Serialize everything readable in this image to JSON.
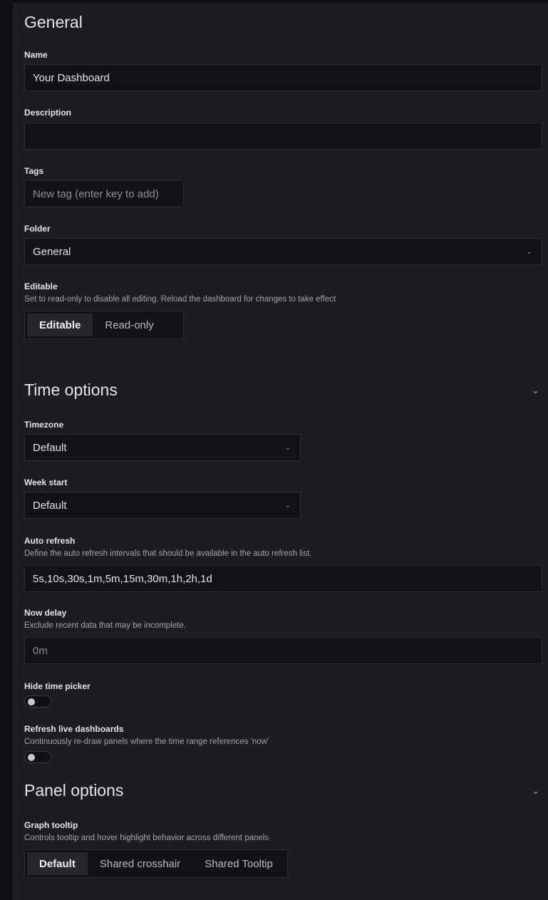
{
  "general": {
    "title": "General",
    "name_label": "Name",
    "name_value": "Your Dashboard",
    "description_label": "Description",
    "description_value": "",
    "tags_label": "Tags",
    "tags_placeholder": "New tag (enter key to add)",
    "folder_label": "Folder",
    "folder_value": "General",
    "editable_label": "Editable",
    "editable_desc": "Set to read-only to disable all editing. Reload the dashboard for changes to take effect",
    "editable_options": [
      "Editable",
      "Read-only"
    ],
    "editable_selected": "Editable"
  },
  "time_options": {
    "title": "Time options",
    "timezone_label": "Timezone",
    "timezone_value": "Default",
    "week_start_label": "Week start",
    "week_start_value": "Default",
    "auto_refresh_label": "Auto refresh",
    "auto_refresh_desc": "Define the auto refresh intervals that should be available in the auto refresh list.",
    "auto_refresh_value": "5s,10s,30s,1m,5m,15m,30m,1h,2h,1d",
    "now_delay_label": "Now delay",
    "now_delay_desc": "Exclude recent data that may be incomplete.",
    "now_delay_placeholder": "0m",
    "hide_time_picker_label": "Hide time picker",
    "hide_time_picker_on": false,
    "refresh_live_label": "Refresh live dashboards",
    "refresh_live_desc": "Continuously re-draw panels where the time range references 'now'",
    "refresh_live_on": false
  },
  "panel_options": {
    "title": "Panel options",
    "graph_tooltip_label": "Graph tooltip",
    "graph_tooltip_desc": "Controls tooltip and hover highlight behavior across different panels",
    "graph_tooltip_options": [
      "Default",
      "Shared crosshair",
      "Shared Tooltip"
    ],
    "graph_tooltip_selected": "Default"
  },
  "colors": {
    "background": "#1c1d21",
    "input_background": "#111217",
    "border": "#2c2e33",
    "text": "#d8d9da"
  },
  "icons": {
    "select_chevron": "chevron-down-icon",
    "section_collapse": "chevron-down-icon"
  }
}
